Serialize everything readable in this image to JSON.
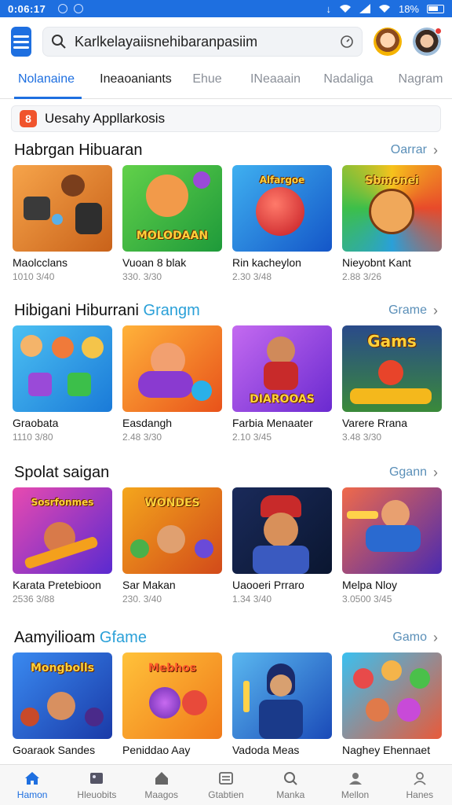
{
  "status_bar": {
    "time": "0:06:17",
    "battery": "18%"
  },
  "search": {
    "query": "Karlkelayaiisnehibaranpasiim"
  },
  "tabs": [
    "Nolanaine",
    "Ineaoaniants",
    "Ehue",
    "INeaaain",
    "Nadaliga",
    "Nagram"
  ],
  "notice": {
    "icon": "8",
    "text": "Uesahy Appllarkosis"
  },
  "sections": [
    {
      "title": "Habrgan Hibuaran",
      "title_accent": "",
      "more": "Oarrar",
      "items": [
        {
          "name": "Maolcclans",
          "meta": "1010 3/40",
          "art": "Controllers",
          "bg": "#e98a2e"
        },
        {
          "name": "Vuoan 8 blak",
          "meta": "330. 3/30",
          "art": "MOLODAAN",
          "bg": "#4cc23c"
        },
        {
          "name": "Rin kacheylon",
          "meta": "2.30 3/48",
          "art": "Alfargoe",
          "bg": "#1f8de0"
        },
        {
          "name": "Nieyobnt Kant",
          "meta": "2.88 3/26",
          "art": "Sbmonei",
          "bg": "#f2b21c"
        }
      ]
    },
    {
      "title": "Hibigani Hiburrani ",
      "title_accent": "Grangm",
      "more": "Grame",
      "items": [
        {
          "name": "Graobata",
          "meta": "1110 3/80",
          "art": "",
          "bg": "#2aa6e8"
        },
        {
          "name": "Easdangh",
          "meta": "2.48 3/30",
          "art": "",
          "bg": "#f58a1f"
        },
        {
          "name": "Farbia Menaater",
          "meta": "2.10 3/45",
          "art": "DIAROOAS",
          "bg": "#7d4ad0"
        },
        {
          "name": "Varere Rrana",
          "meta": "3.48 3/30",
          "art": "Gams",
          "bg": "#2a6bb8"
        }
      ]
    },
    {
      "title": "Spolat saigan",
      "title_accent": "",
      "more": "Ggann",
      "items": [
        {
          "name": "Karata Pretebioon",
          "meta": "2536 3/88",
          "art": "Sosrfonmes",
          "bg": "#8a3bc4"
        },
        {
          "name": "Sar Makan",
          "meta": "230. 3/40",
          "art": "WONDES",
          "bg": "#e67a1c"
        },
        {
          "name": "Uaooeri Prraro",
          "meta": "1.34 3/40",
          "art": "",
          "bg": "#0f4d8a"
        },
        {
          "name": "Melpa Nloy",
          "meta": "3.0500 3/45",
          "art": "",
          "bg": "#5a2fb0"
        }
      ]
    },
    {
      "title": "Aamyilioam ",
      "title_accent": "Gfame",
      "more": "Gamo",
      "items": [
        {
          "name": "Goaraok Sandes",
          "meta": "",
          "art": "Mongbolls",
          "bg": "#2470d8"
        },
        {
          "name": "Peniddao Aay",
          "meta": "",
          "art": "Mebhos",
          "bg": "#f0a41e"
        },
        {
          "name": "Vadoda Meas",
          "meta": "",
          "art": "",
          "bg": "#1c62c8"
        },
        {
          "name": "Naghey Ehennaet",
          "meta": "",
          "art": "",
          "bg": "#21a0e0"
        }
      ]
    }
  ],
  "bottom_nav": [
    {
      "label": "Hamon",
      "icon": "home-icon",
      "active": true
    },
    {
      "label": "Hleuobits",
      "icon": "gallery-icon",
      "active": false
    },
    {
      "label": "Maagos",
      "icon": "house-outline-icon",
      "active": false
    },
    {
      "label": "Gtabtien",
      "icon": "list-icon",
      "active": false
    },
    {
      "label": "Manka",
      "icon": "search-icon",
      "active": false
    },
    {
      "label": "Mellon",
      "icon": "person-group-icon",
      "active": false
    },
    {
      "label": "Hanes",
      "icon": "user-icon",
      "active": false
    }
  ],
  "colors": {
    "accent": "#1e6fe0",
    "teal": "#2aa0d8"
  }
}
